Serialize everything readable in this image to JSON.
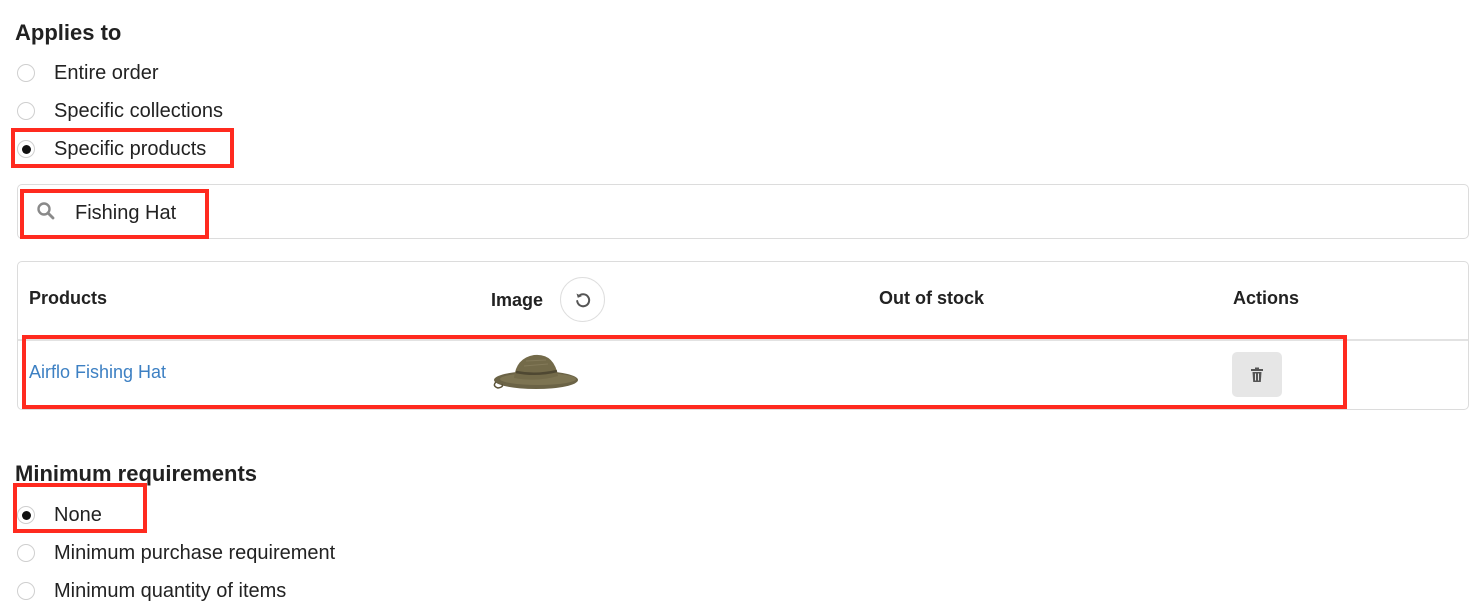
{
  "applies_to": {
    "title": "Applies to",
    "options": [
      {
        "label": "Entire order",
        "checked": false
      },
      {
        "label": "Specific collections",
        "checked": false
      },
      {
        "label": "Specific products",
        "checked": true
      }
    ]
  },
  "search": {
    "value": "Fishing Hat",
    "icon": "search-icon"
  },
  "products_table": {
    "headers": {
      "products": "Products",
      "image": "Image",
      "out_of_stock": "Out of stock",
      "actions": "Actions"
    },
    "reset_icon": "refresh-icon",
    "rows": [
      {
        "product": "Airflo Fishing Hat",
        "image": "fishing-hat-thumbnail",
        "out_of_stock": "",
        "action_icon": "trash-icon"
      }
    ]
  },
  "minimum_requirements": {
    "title": "Minimum requirements",
    "options": [
      {
        "label": "None",
        "checked": true
      },
      {
        "label": "Minimum purchase requirement",
        "checked": false
      },
      {
        "label": "Minimum quantity of items",
        "checked": false
      }
    ]
  },
  "colors": {
    "highlight": "#ff2a1f",
    "link": "#3d80c3"
  }
}
